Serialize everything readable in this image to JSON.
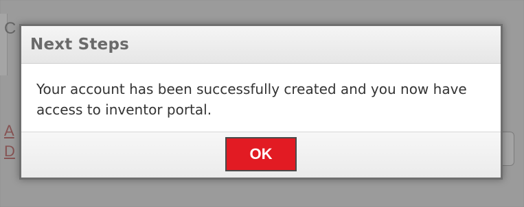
{
  "background": {
    "partial_letter": "C",
    "link_fragment_1": "A",
    "link_fragment_2": "D"
  },
  "dialog": {
    "title": "Next Steps",
    "message": "Your account has been successfully created and you now have access to inventor portal.",
    "ok_label": "OK"
  },
  "colors": {
    "ok_button": "#e21b23",
    "title_text": "#6a6a6a",
    "overlay": "#9a9a9a"
  }
}
